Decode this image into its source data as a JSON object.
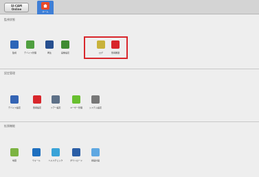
{
  "app": {
    "logo_line1": "SI-CAM",
    "logo_line2": "Online",
    "home_label": "ホーム"
  },
  "sections": [
    {
      "title": "監視状態",
      "items": [
        {
          "label": "監視",
          "icon": "camera-icon",
          "color": "#2d66b8"
        },
        {
          "label": "デバイス管理",
          "icon": "device-management-icon",
          "color": "#4f9f3f"
        },
        {
          "label": "再生",
          "icon": "playback-icon",
          "color": "#274f8f"
        },
        {
          "label": "画像設定",
          "icon": "image-settings-icon",
          "color": "#3f8b32"
        },
        {
          "label": "ログ",
          "icon": "log-icon",
          "color": "#c8b23a"
        },
        {
          "label": "警報履歴",
          "icon": "alarm-history-icon",
          "color": "#d8262b"
        }
      ]
    },
    {
      "title": "設定管理",
      "items": [
        {
          "label": "デバイス設定",
          "icon": "device-settings-icon",
          "color": "#3464b4"
        },
        {
          "label": "警報設定",
          "icon": "alarm-settings-icon",
          "color": "#d8262b"
        },
        {
          "label": "ツアー設定",
          "icon": "tour-settings-icon",
          "color": "#5d7087"
        },
        {
          "label": "ユーザー管理",
          "icon": "user-management-icon",
          "color": "#68bf2f"
        },
        {
          "label": "システム設定",
          "icon": "system-settings-icon",
          "color": "#777777"
        }
      ]
    },
    {
      "title": "拡張機能",
      "items": [
        {
          "label": "地図",
          "icon": "map-icon",
          "color": "#7cb342"
        },
        {
          "label": "ウォール",
          "icon": "video-wall-icon",
          "color": "#1e6fbf"
        },
        {
          "label": "ヘルスチェック",
          "icon": "health-check-icon",
          "color": "#3aa3d8"
        },
        {
          "label": "ダウンロード",
          "icon": "download-icon",
          "color": "#2b5ea6"
        },
        {
          "label": "録画計画",
          "icon": "record-plan-icon",
          "color": "#5fa8e2"
        }
      ]
    }
  ]
}
